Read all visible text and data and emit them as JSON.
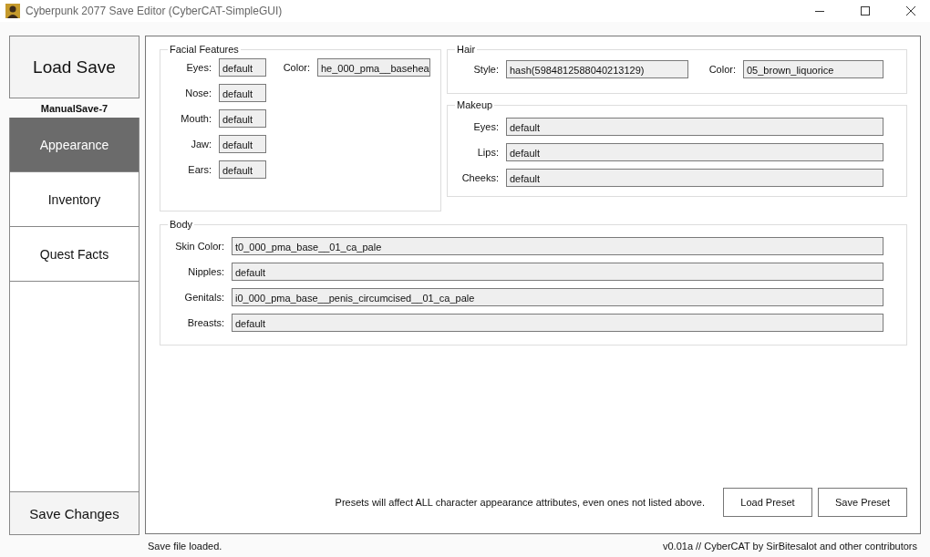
{
  "window": {
    "title": "Cyberpunk 2077 Save Editor (CyberCAT-SimpleGUI)"
  },
  "sidebar": {
    "load_button": "Load Save",
    "save_name": "ManualSave-7",
    "items": [
      {
        "label": "Appearance",
        "selected": true
      },
      {
        "label": "Inventory",
        "selected": false
      },
      {
        "label": "Quest Facts",
        "selected": false
      }
    ],
    "save_button": "Save Changes"
  },
  "facial_features": {
    "title": "Facial Features",
    "color": {
      "label": "Color:",
      "value": "he_000_pma__basehea"
    },
    "fields": [
      {
        "label": "Eyes:",
        "value": "default"
      },
      {
        "label": "Nose:",
        "value": "default"
      },
      {
        "label": "Mouth:",
        "value": "default"
      },
      {
        "label": "Jaw:",
        "value": "default"
      },
      {
        "label": "Ears:",
        "value": "default"
      }
    ]
  },
  "hair": {
    "title": "Hair",
    "fields": [
      {
        "label": "Style:",
        "value": "hash(5984812588040213129)"
      },
      {
        "label": "Color:",
        "value": "05_brown_liquorice"
      }
    ]
  },
  "makeup": {
    "title": "Makeup",
    "fields": [
      {
        "label": "Eyes:",
        "value": "default"
      },
      {
        "label": "Lips:",
        "value": "default"
      },
      {
        "label": "Cheeks:",
        "value": "default"
      }
    ]
  },
  "body": {
    "title": "Body",
    "fields": [
      {
        "label": "Skin Color:",
        "value": "t0_000_pma_base__01_ca_pale"
      },
      {
        "label": "Nipples:",
        "value": "default"
      },
      {
        "label": "Genitals:",
        "value": "i0_000_pma_base__penis_circumcised__01_ca_pale"
      },
      {
        "label": "Breasts:",
        "value": "default"
      }
    ]
  },
  "presets": {
    "note": "Presets will affect ALL character appearance attributes, even ones not listed above.",
    "buttons": [
      "Load Preset",
      "Save Preset"
    ]
  },
  "status_bar": {
    "left": "Save file loaded.",
    "right": "v0.01a // CyberCAT by SirBitesalot and other contributors"
  }
}
